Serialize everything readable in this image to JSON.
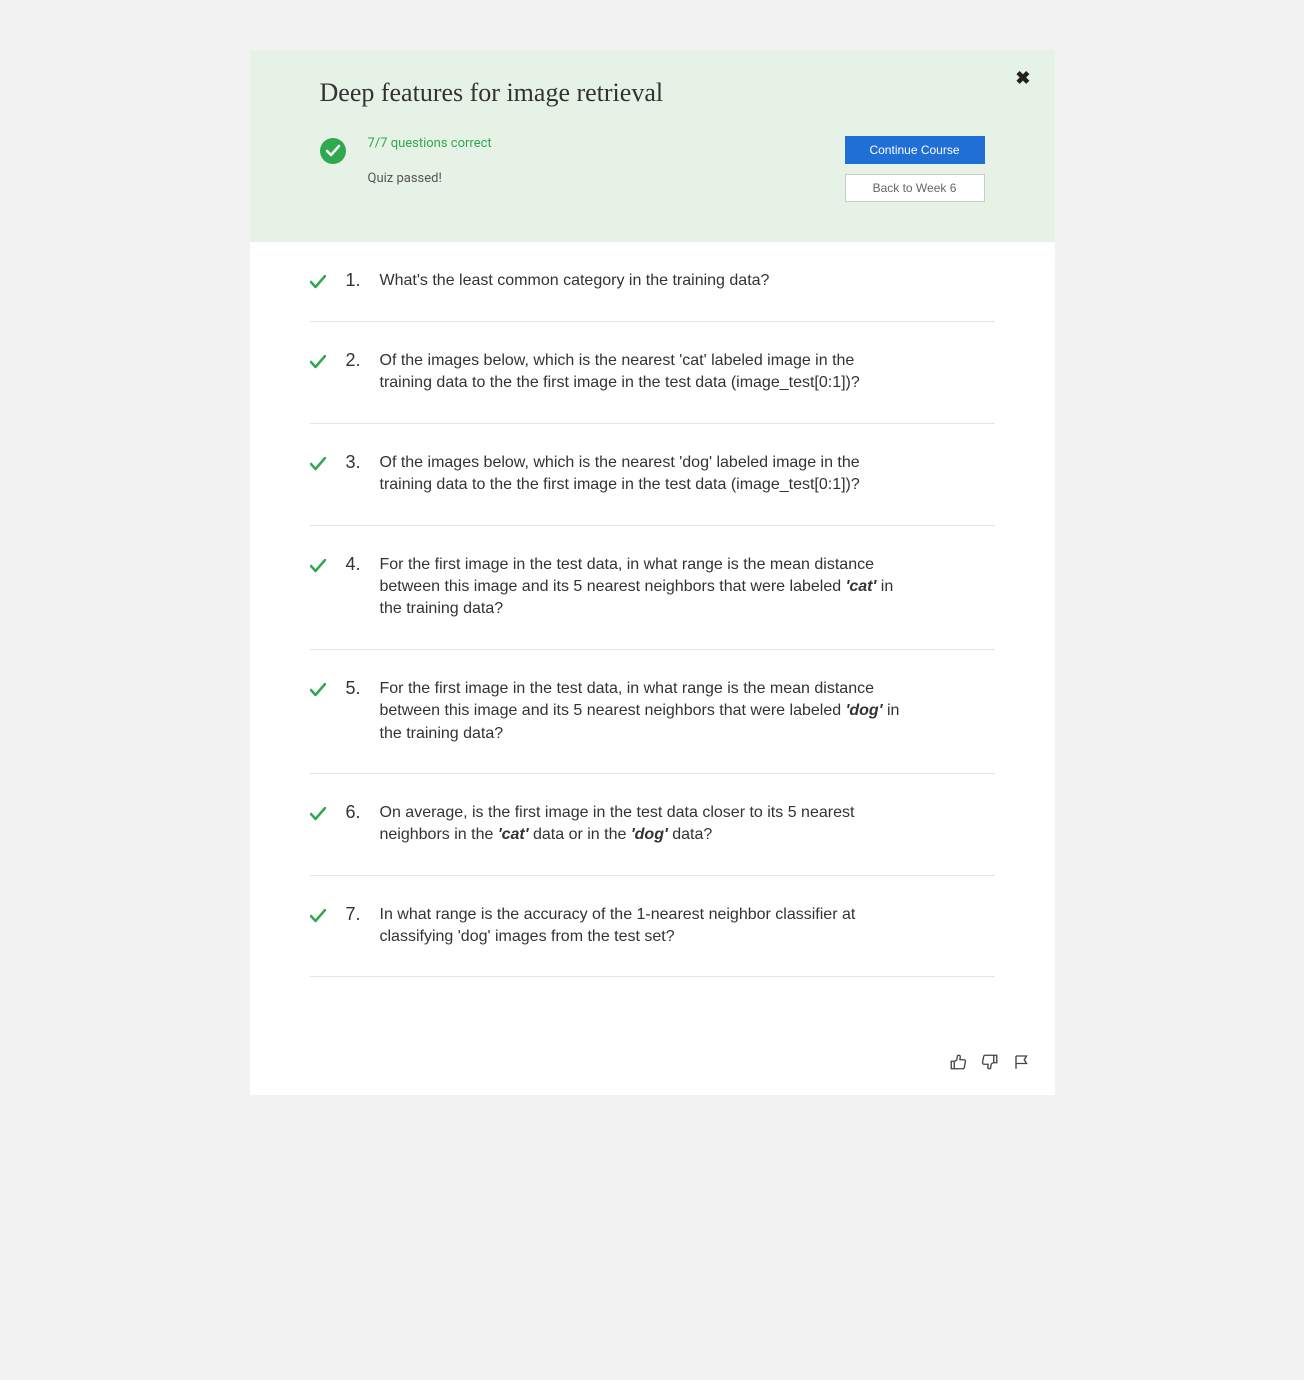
{
  "header": {
    "title": "Deep features for image retrieval",
    "score_text": "7/7 questions correct",
    "passed_text": "Quiz passed!",
    "continue_label": "Continue Course",
    "back_label": "Back to Week 6"
  },
  "questions": [
    {
      "num": "1.",
      "html": "What's the least common category in the training data?"
    },
    {
      "num": "2.",
      "html": "Of the images below, which is the nearest 'cat' labeled image in the training data to the the first image in the test data (image_test[0:1])?"
    },
    {
      "num": "3.",
      "html": "Of the images below, which is the nearest 'dog' labeled image in the training data to the the first image in the test data (image_test[0:1])?"
    },
    {
      "num": "4.",
      "html": "For the first image in the test data, in what range is the mean distance between this image and its 5 nearest neighbors that were labeled <span class='bold-italic'>'cat'</span> in the training data?"
    },
    {
      "num": "5.",
      "html": "For the first image in the test data, in what range is the mean distance between this image and its 5 nearest neighbors that were labeled <span class='bold-italic'>'dog'</span> in the training data?"
    },
    {
      "num": "6.",
      "html": "On average, is the first image in the test data closer to its 5 nearest neighbors in the <span class='bold-italic'>'cat'</span> data or in the <span class='bold-italic'>'dog'</span> data?"
    },
    {
      "num": "7.",
      "html": "In what range is the accuracy of the 1-nearest neighbor classifier at classifying 'dog' images from the test set?"
    }
  ]
}
